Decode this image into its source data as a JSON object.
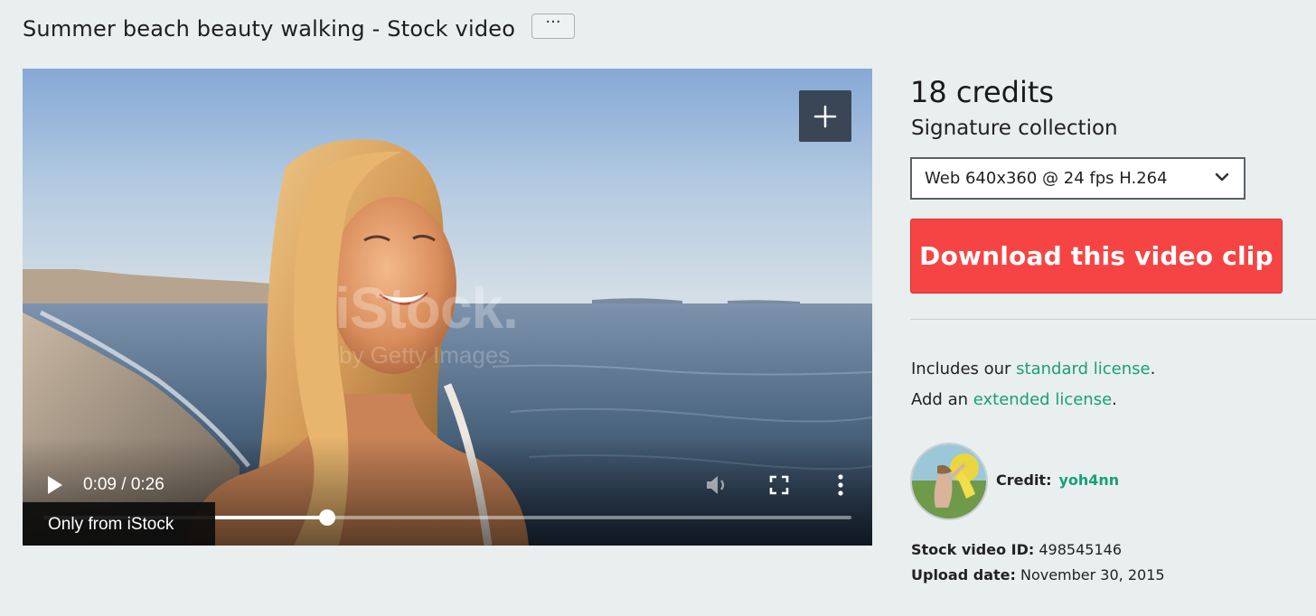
{
  "page": {
    "title": "Summer beach beauty walking - Stock video",
    "more_button_label": "···"
  },
  "player": {
    "time_text": "0:09 / 0:26",
    "progress_fraction": 0.351,
    "only_from_label": "Only from iStock",
    "watermark_text": "iStock.",
    "watermark_sub": "by Getty Images",
    "icons": {
      "add": "plus-icon",
      "play": "play-icon",
      "volume": "volume-icon",
      "fullscreen": "fullscreen-icon",
      "menu": "kebab-menu-icon"
    }
  },
  "sidebar": {
    "credits": "18 credits",
    "collection": "Signature collection",
    "format_selected": "Web 640x360 @ 24 fps H.264",
    "download_label": "Download this video clip",
    "license": {
      "line1_prefix": "Includes our ",
      "line1_link": "standard license",
      "line1_suffix": ".",
      "line2_prefix": "Add an ",
      "line2_link": "extended license",
      "line2_suffix": "."
    },
    "credit_label": "Credit:",
    "credit_name": "yoh4nn",
    "video_id_label": "Stock video ID:",
    "video_id": "498545146",
    "upload_label": "Upload date:",
    "upload_date": "November 30, 2015"
  },
  "colors": {
    "page_bg": "#e9eeee",
    "download_bg": "#f64445",
    "link": "#18a078",
    "add_button_bg": "#3a4655"
  }
}
